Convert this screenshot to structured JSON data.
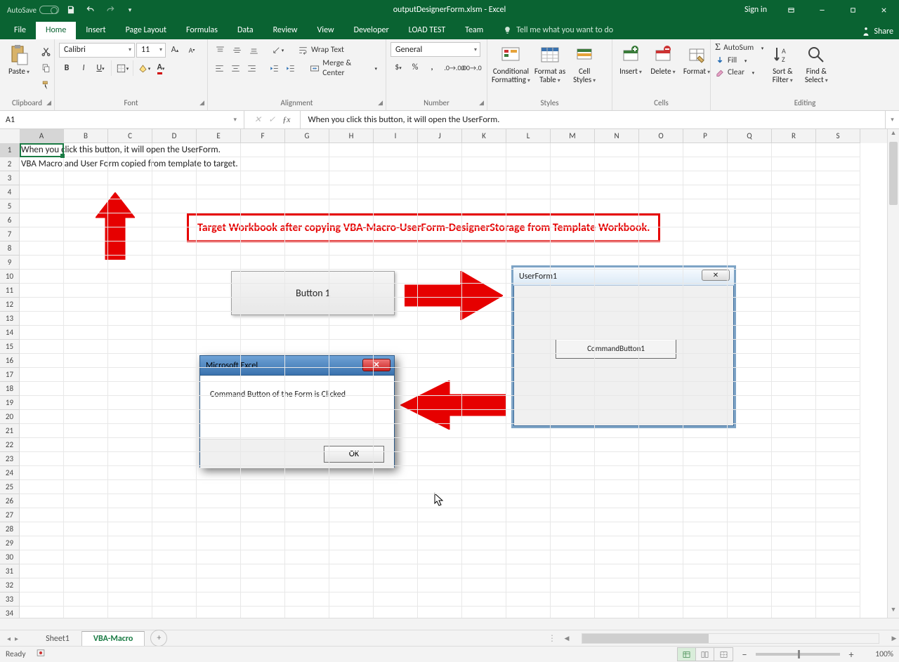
{
  "titlebar": {
    "autosave": "AutoSave",
    "title": "outputDesignerForm.xlsm - Excel",
    "signin": "Sign in"
  },
  "tabs": [
    "File",
    "Home",
    "Insert",
    "Page Layout",
    "Formulas",
    "Data",
    "Review",
    "View",
    "Developer",
    "LOAD TEST",
    "Team"
  ],
  "activeTab": "Home",
  "tellme": "Tell me what you want to do",
  "share": "Share",
  "ribbon": {
    "clipboard": {
      "label": "Clipboard",
      "paste": "Paste"
    },
    "font": {
      "label": "Font",
      "name": "Calibri",
      "size": "11"
    },
    "alignment": {
      "label": "Alignment",
      "wrap": "Wrap Text",
      "merge": "Merge & Center"
    },
    "number": {
      "label": "Number",
      "format": "General"
    },
    "styles": {
      "label": "Styles",
      "cond": "Conditional\nFormatting",
      "table": "Format as\nTable",
      "cell": "Cell\nStyles"
    },
    "cells": {
      "label": "Cells",
      "insert": "Insert",
      "delete": "Delete",
      "format": "Format"
    },
    "editing": {
      "label": "Editing",
      "autosum": "AutoSum",
      "fill": "Fill",
      "clear": "Clear",
      "sort": "Sort &\nFilter",
      "find": "Find &\nSelect"
    }
  },
  "namebox": "A1",
  "formula": "When you click this button, it will open the UserForm.",
  "columns": [
    "A",
    "B",
    "C",
    "D",
    "E",
    "F",
    "G",
    "H",
    "I",
    "J",
    "K",
    "L",
    "M",
    "N",
    "O",
    "P",
    "Q",
    "R",
    "S"
  ],
  "rows": 34,
  "cellA1": "When you click this button, it will open the UserForm.",
  "cellA2": "VBA Macro and User Form copied from template to target.",
  "callout": "Target Workbook after copying VBA-Macro-UserForm-DesignerStorage from Template Workbook.",
  "button1": "Button 1",
  "userform": {
    "title": "UserForm1",
    "cmd": "CommandButton1",
    "closeGlyph": "✕"
  },
  "msgbox": {
    "title": "Microsoft Excel",
    "body": "Command Button of the Form is Clicked",
    "ok": "OK",
    "closeGlyph": "✕"
  },
  "sheets": {
    "nav": [
      "◂",
      "▸"
    ],
    "inactive": "Sheet1",
    "active": "VBA-Macro",
    "new": "+"
  },
  "status": {
    "ready": "Ready",
    "zoom": "100%"
  }
}
